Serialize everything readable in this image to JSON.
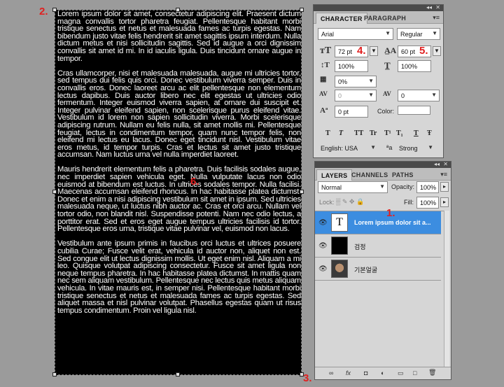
{
  "steps": {
    "s1": "1.",
    "s2": "2.",
    "s3": "3.",
    "s4": "4.",
    "s5": "5.",
    "s6": "6."
  },
  "canvas": {
    "paragraphs": [
      "Lorem ipsum dolor sit amet, consectetur adipiscing elit. Praesent dictum magna convallis tortor pharetra feugiat. Pellentesque habitant morbi tristique senectus et netus et malesuada fames ac turpis egestas. Nam bibendum justo vitae felis hendrerit sit amet sagittis ipsum interdum. Nulla dictum metus et nisi sollicitudin sagittis. Sed id augue a orci dignissim convallis sit amet id mi. In id iaculis ligula. Duis tincidunt ornare augue in tempor.",
      "Cras ullamcorper, nisi et malesuada malesuada, augue mi ultricies tortor, sed tempus dui felis quis orci. Donec vestibulum viverra semper. Duis in convallis eros. Donec laoreet arcu ac elit pellentesque non elementum lectus dapibus. Duis auctor libero nec elit egestas ut ultricies odio fermentum. Integer euismod viverra sapien, at ornare dui suscipit et. Integer pulvinar eleifend sapien, non scelerisque purus eleifend vitae. Vestibulum id lorem non sapien sollicitudin viverra. Morbi scelerisque adipiscing rutrum. Nullam eu felis nulla, sit amet mollis mi. Pellentesque feugiat, lectus in condimentum tempor, quam nunc tempor felis, non eleifend mi lectus eu lacus. Donec eget tincidunt nisl. Vestibulum vitae eros metus, id tempor turpis. Cras et lectus sit amet justo tristique accumsan. Nam luctus urna vel nulla imperdiet laoreet.",
      "Mauris hendrerit elementum felis a pharetra. Duis facilisis sodales augue, nec imperdiet sapien vehicula eget. Nulla vulputate lacus non odio euismod at bibendum est luctus. In ultrices sodales tempor. Nulla facilisi. Maecenas accumsan eleifend rhoncus. In hac habitasse platea dictumst. Donec et enim a nisi adipiscing vestibulum sit amet in ipsum. Sed ultricies malesuada neque, ut luctus nibh auctor ac. Cras et orci arcu. Nullam vel tortor odio, non blandit nisl. Suspendisse potenti. Nam nec odio lectus, a porttitor erat. Sed et eros eget augue tempus ultricies facilisis id tortor. Pellentesque eros urna, tristique vitae pulvinar vel, euismod non lacus.",
      "Vestibulum ante ipsum primis in faucibus orci luctus et ultrices posuere cubilia Curae; Fusce velit erat, vehicula id auctor non, aliquet non est. Sed congue elit ut lectus dignissim mollis. Ut eget enim nisl. Aliquam a mi leo. Quisque volutpat adipiscing consectetur. Fusce sit amet ligula non neque tempus pharetra. In hac habitasse platea dictumst. In mattis quam nec sem aliquam vestibulum. Pellentesque nec lectus quis metus aliquam vehicula. In vitae mauris est, in semper nisi. Pellentesque habitant morbi tristique senectus et netus et malesuada fames ac turpis egestas. Sed aliquet massa et nisl pulvinar volutpat. Phasellus egestas quam ut risus tempus condimentum. Proin vel ligula nisl."
    ]
  },
  "character": {
    "tab_character": "CHARACTER",
    "tab_paragraph": "PARAGRAPH",
    "font_family": "Arial",
    "font_style": "Regular",
    "font_size": "72 pt",
    "leading": "60 pt",
    "vertical_scale": "100%",
    "horizontal_scale": "100%",
    "tsume": "0%",
    "kerning": "0",
    "tracking": "0",
    "baseline_shift": "0 pt",
    "color_label": "Color:",
    "style_buttons": [
      "T",
      "T",
      "TT",
      "Tr",
      "T¹",
      "T₁",
      "T",
      "Ŧ"
    ],
    "language": "English: USA",
    "aa_label": "ªa",
    "antialias": "Strong"
  },
  "layers": {
    "tab_layers": "LAYERS",
    "tab_channels": "CHANNELS",
    "tab_paths": "PATHS",
    "blend_mode": "Normal",
    "opacity_label": "Opacity:",
    "opacity": "100%",
    "lock_label": "Lock:",
    "fill_label": "Fill:",
    "fill": "100%",
    "items": [
      {
        "name": "Lorem ipsum dolor sit a...",
        "thumb": "T"
      },
      {
        "name": "검정",
        "thumb": ""
      },
      {
        "name": "기본얼굴",
        "thumb": ""
      }
    ],
    "footer_icons": [
      "∞",
      "fx",
      "◘",
      "◐",
      "▭",
      "□",
      "🗑"
    ]
  }
}
